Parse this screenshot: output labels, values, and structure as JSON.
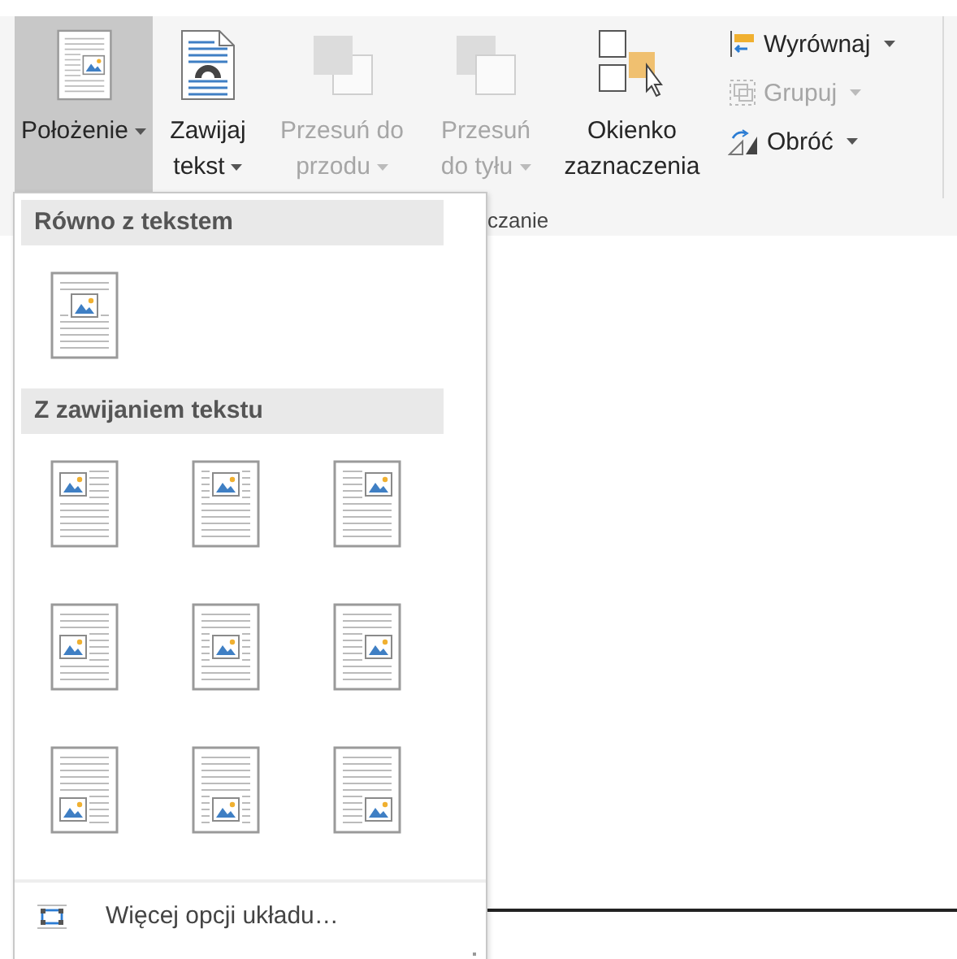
{
  "ribbon": {
    "buttons": [
      {
        "label": "Położenie",
        "dropdown": true,
        "selected": true,
        "disabled": false
      },
      {
        "label": "Zawijaj tekst",
        "dropdown": true,
        "selected": false,
        "disabled": false
      },
      {
        "label": "Przesuń do przodu",
        "dropdown": true,
        "selected": false,
        "disabled": true
      },
      {
        "label": "Przesuń do tyłu",
        "dropdown": true,
        "selected": false,
        "disabled": true
      },
      {
        "label": "Okienko zaznaczenia",
        "dropdown": false,
        "selected": false,
        "disabled": false
      }
    ],
    "small_buttons": [
      {
        "label": "Wyrównaj",
        "dropdown": true,
        "disabled": false
      },
      {
        "label": "Grupuj",
        "dropdown": true,
        "disabled": true
      },
      {
        "label": "Obróć",
        "dropdown": true,
        "disabled": false
      }
    ],
    "group_label": "czanie"
  },
  "position_menu": {
    "sections": [
      {
        "title": "Równo z tekstem",
        "items": [
          {
            "kind": "inline"
          }
        ]
      },
      {
        "title": "Z zawijaniem tekstu",
        "items": [
          {
            "kind": "top-left"
          },
          {
            "kind": "top-center"
          },
          {
            "kind": "top-right"
          },
          {
            "kind": "middle-left"
          },
          {
            "kind": "middle-center"
          },
          {
            "kind": "middle-right"
          },
          {
            "kind": "bottom-left"
          },
          {
            "kind": "bottom-center"
          },
          {
            "kind": "bottom-right"
          }
        ]
      }
    ],
    "footer": {
      "label": "Więcej opcji układu…"
    }
  }
}
